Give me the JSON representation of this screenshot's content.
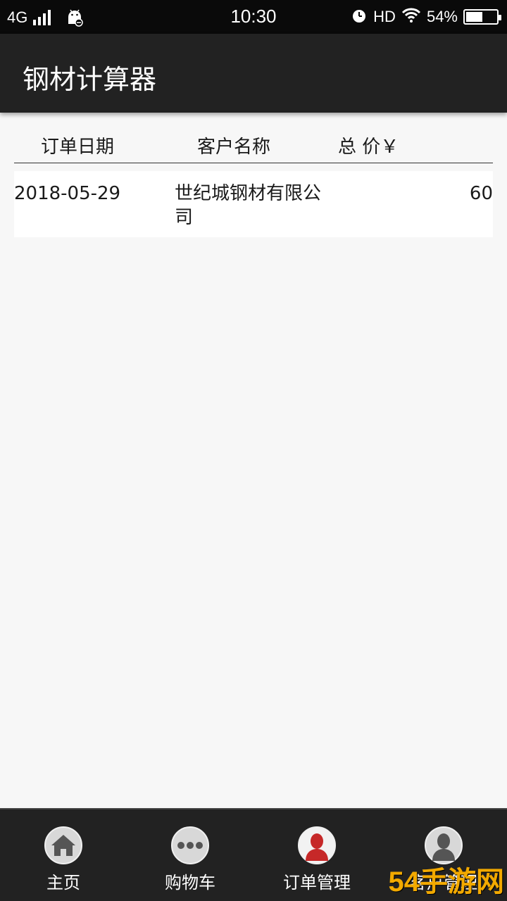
{
  "status_bar": {
    "network": "4G",
    "time": "10:30",
    "hd": "HD",
    "battery_percent": "54%",
    "battery_level": 0.54
  },
  "app_bar": {
    "title": "钢材计算器"
  },
  "table": {
    "headers": {
      "date": "订单日期",
      "customer": "客户名称",
      "total": "总 价￥"
    },
    "rows": [
      {
        "date": "2018-05-29",
        "customer": "世纪城钢材有限公司",
        "total": "60"
      }
    ]
  },
  "bottom_nav": {
    "items": [
      {
        "label": "主页",
        "icon": "home-icon"
      },
      {
        "label": "购物车",
        "icon": "more-dots-icon"
      },
      {
        "label": "订单管理",
        "icon": "order-person-icon",
        "active": true
      },
      {
        "label": "客户管理",
        "icon": "user-icon"
      }
    ]
  },
  "watermark": {
    "text": "54手游网"
  },
  "colors": {
    "status_bar": "#0a0a0a",
    "app_bar": "#222222",
    "background": "#f7f7f7",
    "active_icon": "#c62828"
  }
}
